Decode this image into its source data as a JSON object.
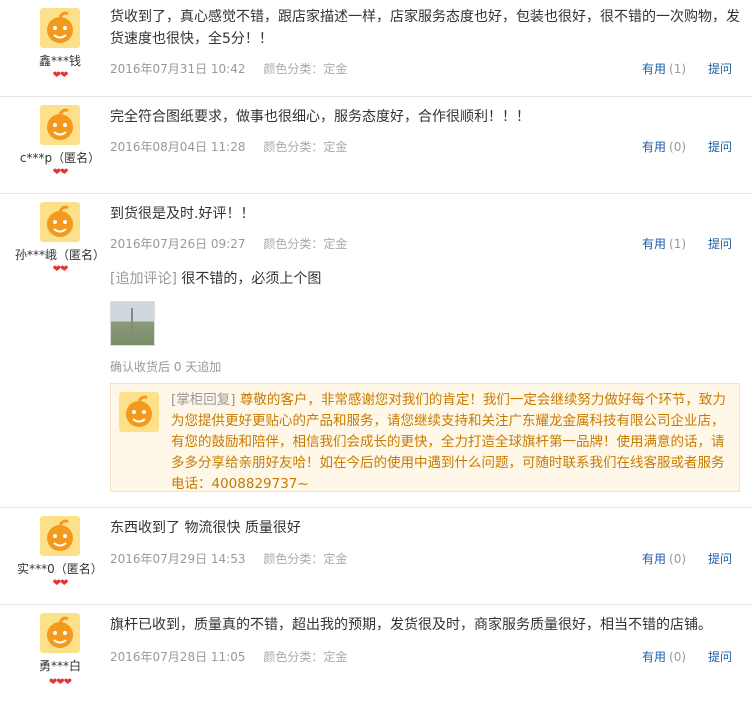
{
  "colors": {
    "link": "#1d5ea5",
    "reply_text": "#c77a00",
    "reply_bg": "#fff8e8",
    "heart": "#e8323a"
  },
  "reviews": [
    {
      "username": "鑫***钱",
      "hearts": "❤❤",
      "content": "货收到了，真心感觉不错，跟店家描述一样，店家服务态度也好，包装也很好，很不错的一次购物，发货速度也很快，全5分！！",
      "date": "2016年07月31日 10:42",
      "color_label": "颜色分类：",
      "color_value": "定金",
      "useful_label": "有用",
      "useful_count": "(1)",
      "ask_label": "提问"
    },
    {
      "username": "c***p（匿名）",
      "hearts": "❤❤",
      "content": "完全符合图纸要求，做事也很细心，服务态度好，合作很顺利！！！",
      "date": "2016年08月04日 11:28",
      "color_label": "颜色分类：",
      "color_value": "定金",
      "useful_label": "有用",
      "useful_count": "(0)",
      "ask_label": "提问"
    },
    {
      "username": "孙***峨（匿名）",
      "hearts": "❤❤",
      "content": "到货很是及时.好评！！",
      "date": "2016年07月26日 09:27",
      "color_label": "颜色分类：",
      "color_value": "定金",
      "useful_label": "有用",
      "useful_count": "(1)",
      "ask_label": "提问",
      "append_label": "[追加评论]",
      "append_text": "很不错的，必须上个图",
      "confirm_text": "确认收货后 0 天追加",
      "reply_label": "[掌柜回复]",
      "reply_text": "尊敬的客户，非常感谢您对我们的肯定！我们一定会继续努力做好每个环节，致力为您提供更好更贴心的产品和服务，请您继续支持和关注广东耀龙金属科技有限公司企业店，有您的鼓励和陪伴，相信我们会成长的更快，全力打造全球旗杆第一品牌！使用满意的话，请多多分享给亲朋好友哈！如在今后的使用中遇到什么问题，可随时联系我们在线客服或者服务电话：4008829737~"
    },
    {
      "username": "实***0（匿名）",
      "hearts": "❤❤",
      "content": "东西收到了 物流很快 质量很好",
      "date": "2016年07月29日 14:53",
      "color_label": "颜色分类：",
      "color_value": "定金",
      "useful_label": "有用",
      "useful_count": "(0)",
      "ask_label": "提问"
    },
    {
      "username": "勇***白",
      "hearts": "❤❤❤",
      "content": "旗杆已收到，质量真的不错，超出我的预期，发货很及时，商家服务质量很好，相当不错的店铺。",
      "date": "2016年07月28日 11:05",
      "color_label": "颜色分类：",
      "color_value": "定金",
      "useful_label": "有用",
      "useful_count": "(0)",
      "ask_label": "提问"
    }
  ]
}
